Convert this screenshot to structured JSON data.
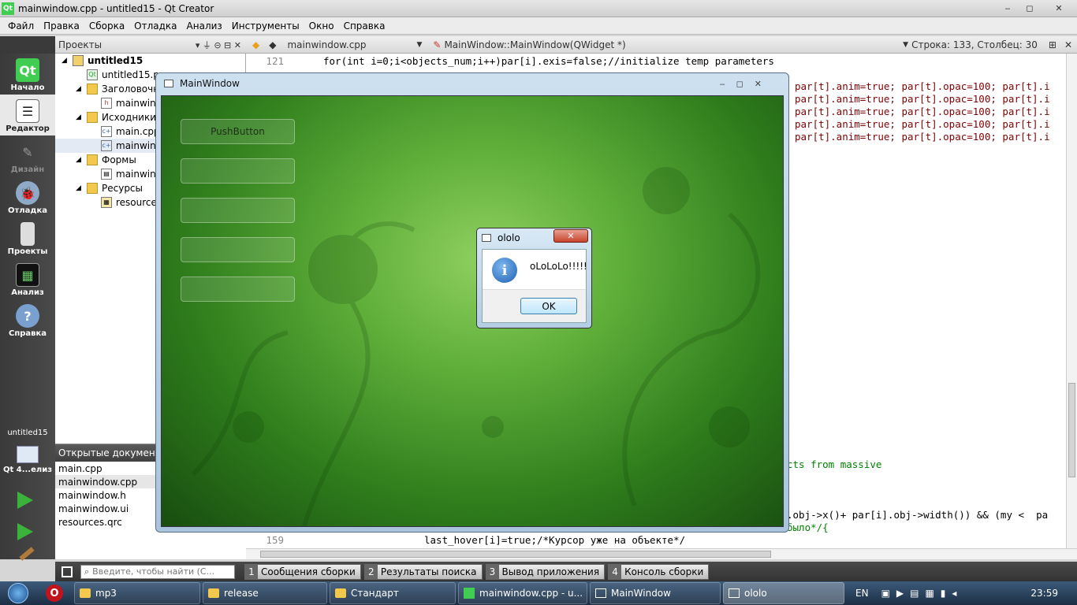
{
  "window_title": "mainwindow.cpp - untitled15 - Qt Creator",
  "title_controls": [
    "‒",
    "◻",
    "✕"
  ],
  "menu": [
    "Файл",
    "Правка",
    "Сборка",
    "Отладка",
    "Анализ",
    "Инструменты",
    "Окно",
    "Справка"
  ],
  "modes": [
    {
      "label": "Начало",
      "icon": "qt-logo-icon"
    },
    {
      "label": "Редактор",
      "icon": "editor-icon"
    },
    {
      "label": "Дизайн",
      "icon": "design-icon"
    },
    {
      "label": "Отладка",
      "icon": "debug-icon"
    },
    {
      "label": "Проекты",
      "icon": "projects-icon"
    },
    {
      "label": "Анализ",
      "icon": "analyze-icon"
    },
    {
      "label": "Справка",
      "icon": "help-icon"
    }
  ],
  "kit": {
    "project": "untitled15",
    "kit": "Qt 4...елиз"
  },
  "projects_panel": {
    "title": "Проекты"
  },
  "tree": [
    {
      "text": "untitled15",
      "level": 0,
      "bold": true
    },
    {
      "text": "untitled15.pro",
      "level": 1
    },
    {
      "text": "Заголовочные",
      "level": 1
    },
    {
      "text": "mainwindow.h",
      "level": 2
    },
    {
      "text": "Исходники",
      "level": 1
    },
    {
      "text": "main.cpp",
      "level": 2
    },
    {
      "text": "mainwindow.cpp",
      "level": 2
    },
    {
      "text": "Формы",
      "level": 1
    },
    {
      "text": "mainwindow.ui",
      "level": 2
    },
    {
      "text": "Ресурсы",
      "level": 1
    },
    {
      "text": "resources.qrc",
      "level": 2
    }
  ],
  "open_docs": {
    "title": "Открытые документы",
    "items": [
      "main.cpp",
      "mainwindow.cpp",
      "mainwindow.h",
      "mainwindow.ui",
      "resources.qrc"
    ]
  },
  "editor_header": {
    "file": "mainwindow.cpp",
    "symbol": "MainWindow::MainWindow(QWidget *)",
    "position": "Строка: 133, Столбец: 30"
  },
  "code": {
    "line121_num": "121",
    "line121": "for(int i=0;i<objects_num;i++)par[i].exis=false;//initialize temp parameters",
    "partial_right": "par[t].anim=true; par[t].opac=100; par[t].i",
    "massive": "cts from massive",
    "objx": ".obj->x()+ par[i].obj->width()) && (my <  pa",
    "bylo": "было*/{",
    "line159_num": "159",
    "line159": "last_hover[i]=true;/*Курсор уже на объекте*/"
  },
  "search_placeholder": "Введите, чтобы найти (С...",
  "output_tabs": [
    {
      "n": "1",
      "label": "Сообщения сборки"
    },
    {
      "n": "2",
      "label": "Результаты поиска"
    },
    {
      "n": "3",
      "label": "Вывод приложения"
    },
    {
      "n": "4",
      "label": "Консоль сборки"
    }
  ],
  "mainwindow": {
    "title": "MainWindow",
    "buttons": [
      "PushButton",
      "",
      "",
      "",
      ""
    ]
  },
  "dialog": {
    "title": "ololo",
    "message": "oLoLoLo!!!!!",
    "ok": "OK"
  },
  "taskbar": {
    "items": [
      "mp3",
      "release",
      "Стандарт",
      "mainwindow.cpp - u...",
      "MainWindow",
      "ololo"
    ],
    "lang": "EN",
    "time": "23:59"
  },
  "colors": {
    "qt_green": "#41cd52",
    "sidebar": "#404040"
  }
}
